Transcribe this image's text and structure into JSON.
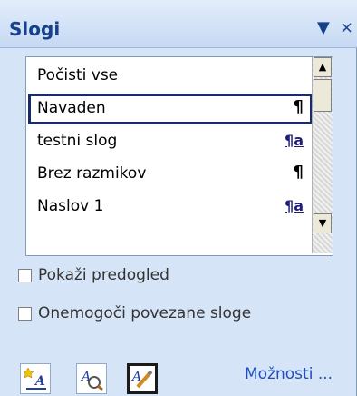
{
  "pane": {
    "title": "Slogi",
    "dropdown_icon": "▼",
    "close_icon": "×"
  },
  "styles_list": [
    {
      "label": "Počisti vse",
      "mark": ""
    },
    {
      "label": "Navaden",
      "mark": "¶",
      "selected": true
    },
    {
      "label": "testni slog",
      "mark": "¶a"
    },
    {
      "label": "Brez razmikov",
      "mark": "¶"
    },
    {
      "label": "Naslov 1",
      "mark": "¶a"
    }
  ],
  "scrollbar": {
    "up_icon": "▲",
    "down_icon": "▼"
  },
  "options": {
    "show_preview": {
      "label": "Pokaži predogled",
      "checked": false
    },
    "disable_linked": {
      "label": "Onemogoči povezane sloge",
      "checked": false
    }
  },
  "toolbar": {
    "new_style_icon": "new-style-icon",
    "style_inspector_icon": "style-inspector-icon",
    "manage_styles_icon": "manage-styles-icon",
    "options_link": "Možnosti ..."
  }
}
